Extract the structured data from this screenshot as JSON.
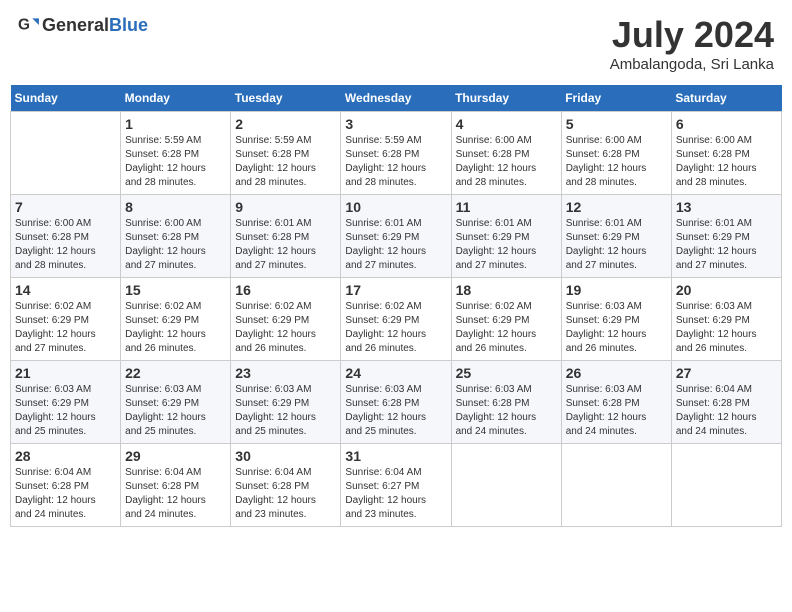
{
  "header": {
    "logo": {
      "text_general": "General",
      "text_blue": "Blue"
    },
    "title": "July 2024",
    "subtitle": "Ambalangoda, Sri Lanka"
  },
  "days_of_week": [
    "Sunday",
    "Monday",
    "Tuesday",
    "Wednesday",
    "Thursday",
    "Friday",
    "Saturday"
  ],
  "weeks": [
    [
      {
        "day": "",
        "info": ""
      },
      {
        "day": "1",
        "info": "Sunrise: 5:59 AM\nSunset: 6:28 PM\nDaylight: 12 hours\nand 28 minutes."
      },
      {
        "day": "2",
        "info": "Sunrise: 5:59 AM\nSunset: 6:28 PM\nDaylight: 12 hours\nand 28 minutes."
      },
      {
        "day": "3",
        "info": "Sunrise: 5:59 AM\nSunset: 6:28 PM\nDaylight: 12 hours\nand 28 minutes."
      },
      {
        "day": "4",
        "info": "Sunrise: 6:00 AM\nSunset: 6:28 PM\nDaylight: 12 hours\nand 28 minutes."
      },
      {
        "day": "5",
        "info": "Sunrise: 6:00 AM\nSunset: 6:28 PM\nDaylight: 12 hours\nand 28 minutes."
      },
      {
        "day": "6",
        "info": "Sunrise: 6:00 AM\nSunset: 6:28 PM\nDaylight: 12 hours\nand 28 minutes."
      }
    ],
    [
      {
        "day": "7",
        "info": "Sunrise: 6:00 AM\nSunset: 6:28 PM\nDaylight: 12 hours\nand 28 minutes."
      },
      {
        "day": "8",
        "info": "Sunrise: 6:00 AM\nSunset: 6:28 PM\nDaylight: 12 hours\nand 27 minutes."
      },
      {
        "day": "9",
        "info": "Sunrise: 6:01 AM\nSunset: 6:28 PM\nDaylight: 12 hours\nand 27 minutes."
      },
      {
        "day": "10",
        "info": "Sunrise: 6:01 AM\nSunset: 6:29 PM\nDaylight: 12 hours\nand 27 minutes."
      },
      {
        "day": "11",
        "info": "Sunrise: 6:01 AM\nSunset: 6:29 PM\nDaylight: 12 hours\nand 27 minutes."
      },
      {
        "day": "12",
        "info": "Sunrise: 6:01 AM\nSunset: 6:29 PM\nDaylight: 12 hours\nand 27 minutes."
      },
      {
        "day": "13",
        "info": "Sunrise: 6:01 AM\nSunset: 6:29 PM\nDaylight: 12 hours\nand 27 minutes."
      }
    ],
    [
      {
        "day": "14",
        "info": "Sunrise: 6:02 AM\nSunset: 6:29 PM\nDaylight: 12 hours\nand 27 minutes."
      },
      {
        "day": "15",
        "info": "Sunrise: 6:02 AM\nSunset: 6:29 PM\nDaylight: 12 hours\nand 26 minutes."
      },
      {
        "day": "16",
        "info": "Sunrise: 6:02 AM\nSunset: 6:29 PM\nDaylight: 12 hours\nand 26 minutes."
      },
      {
        "day": "17",
        "info": "Sunrise: 6:02 AM\nSunset: 6:29 PM\nDaylight: 12 hours\nand 26 minutes."
      },
      {
        "day": "18",
        "info": "Sunrise: 6:02 AM\nSunset: 6:29 PM\nDaylight: 12 hours\nand 26 minutes."
      },
      {
        "day": "19",
        "info": "Sunrise: 6:03 AM\nSunset: 6:29 PM\nDaylight: 12 hours\nand 26 minutes."
      },
      {
        "day": "20",
        "info": "Sunrise: 6:03 AM\nSunset: 6:29 PM\nDaylight: 12 hours\nand 26 minutes."
      }
    ],
    [
      {
        "day": "21",
        "info": "Sunrise: 6:03 AM\nSunset: 6:29 PM\nDaylight: 12 hours\nand 25 minutes."
      },
      {
        "day": "22",
        "info": "Sunrise: 6:03 AM\nSunset: 6:29 PM\nDaylight: 12 hours\nand 25 minutes."
      },
      {
        "day": "23",
        "info": "Sunrise: 6:03 AM\nSunset: 6:29 PM\nDaylight: 12 hours\nand 25 minutes."
      },
      {
        "day": "24",
        "info": "Sunrise: 6:03 AM\nSunset: 6:28 PM\nDaylight: 12 hours\nand 25 minutes."
      },
      {
        "day": "25",
        "info": "Sunrise: 6:03 AM\nSunset: 6:28 PM\nDaylight: 12 hours\nand 24 minutes."
      },
      {
        "day": "26",
        "info": "Sunrise: 6:03 AM\nSunset: 6:28 PM\nDaylight: 12 hours\nand 24 minutes."
      },
      {
        "day": "27",
        "info": "Sunrise: 6:04 AM\nSunset: 6:28 PM\nDaylight: 12 hours\nand 24 minutes."
      }
    ],
    [
      {
        "day": "28",
        "info": "Sunrise: 6:04 AM\nSunset: 6:28 PM\nDaylight: 12 hours\nand 24 minutes."
      },
      {
        "day": "29",
        "info": "Sunrise: 6:04 AM\nSunset: 6:28 PM\nDaylight: 12 hours\nand 24 minutes."
      },
      {
        "day": "30",
        "info": "Sunrise: 6:04 AM\nSunset: 6:28 PM\nDaylight: 12 hours\nand 23 minutes."
      },
      {
        "day": "31",
        "info": "Sunrise: 6:04 AM\nSunset: 6:27 PM\nDaylight: 12 hours\nand 23 minutes."
      },
      {
        "day": "",
        "info": ""
      },
      {
        "day": "",
        "info": ""
      },
      {
        "day": "",
        "info": ""
      }
    ]
  ]
}
